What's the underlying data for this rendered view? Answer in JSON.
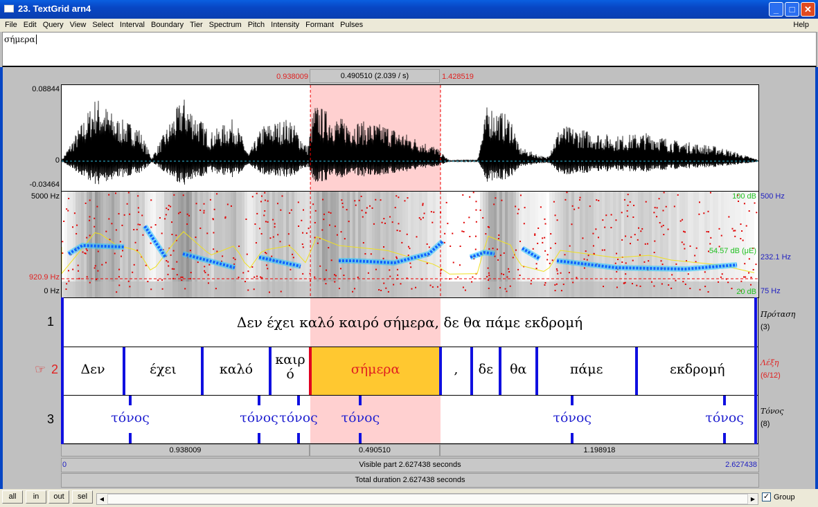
{
  "window": {
    "title": "23. TextGrid arn4",
    "min": "_",
    "max": "□",
    "close": "✕"
  },
  "menu": [
    "File",
    "Edit",
    "Query",
    "View",
    "Select",
    "Interval",
    "Boundary",
    "Tier",
    "Spectrum",
    "Pitch",
    "Intensity",
    "Formant",
    "Pulses"
  ],
  "help": "Help",
  "text_value": "σήμερα",
  "selection": {
    "start": "0.938009",
    "duration": "0.490510 (2.039 / s)",
    "end": "1.428519",
    "start_s": 0.938009,
    "end_s": 1.428519,
    "total_s": 2.627438
  },
  "waveform": {
    "max": "0.08844",
    "zero": "0",
    "min": "-0.03464"
  },
  "spectrogram": {
    "top": "5000 Hz",
    "bottom": "0 Hz",
    "cursor": "920.9 Hz",
    "pitch_top": "500 Hz",
    "pitch_mid": "232.1 Hz",
    "pitch_bottom": "75 Hz",
    "int_top": "100 dB",
    "int_mid": "54.57 dB (μE)",
    "int_bottom": "20 dB"
  },
  "tiers": [
    {
      "num": "1",
      "name": "Πρόταση",
      "count": "(3)",
      "intervals": [
        {
          "text": "Δεν έχει καλό καιρό σήμερα, δε θα πάμε εκδρομή",
          "start": 0,
          "end": 2.627438
        }
      ]
    },
    {
      "num": "2",
      "name": "Λέξη",
      "count": "(6/12)",
      "selected": true,
      "pointer": "☞",
      "boundaries": [
        0.2352,
        0.5299,
        0.7862,
        0.938009,
        1.428519,
        1.5457,
        1.6527,
        1.791,
        2.1668
      ],
      "labels": [
        "Δεν",
        "έχει",
        "καλό",
        "καιρ\nό",
        "σήμερα",
        ",",
        "δε",
        "θα",
        "πάμε",
        "εκδρομή"
      ]
    },
    {
      "num": "3",
      "name": "Τόνος",
      "count": "(8)",
      "points": [
        {
          "t": 0.2587,
          "text": "τόνος"
        },
        {
          "t": 0.7444,
          "text": "τόνος"
        },
        {
          "t": 0.8933,
          "text": "τόνος"
        },
        {
          "t": 1.1269,
          "text": "τόνος"
        },
        {
          "t": 1.9256,
          "text": "τόνος"
        },
        {
          "t": 2.4999,
          "text": "τόνος"
        }
      ]
    }
  ],
  "durations": {
    "left": "0.938009",
    "sel": "0.490510",
    "right": "1.198918",
    "vis_start": "0",
    "visible": "Visible part 2.627438 seconds",
    "vis_end": "2.627438",
    "total": "Total duration 2.627438 seconds"
  },
  "buttons": {
    "all": "all",
    "in": "in",
    "out": "out",
    "sel": "sel"
  },
  "group_label": "Group",
  "group_checked": true,
  "colors": {
    "selection": "#ffd0d0",
    "selected_interval": "#ffc830",
    "boundary": "#1010e0",
    "pitch": "#1060ff",
    "formant": "#e00000",
    "intensity": "#f0e020"
  }
}
